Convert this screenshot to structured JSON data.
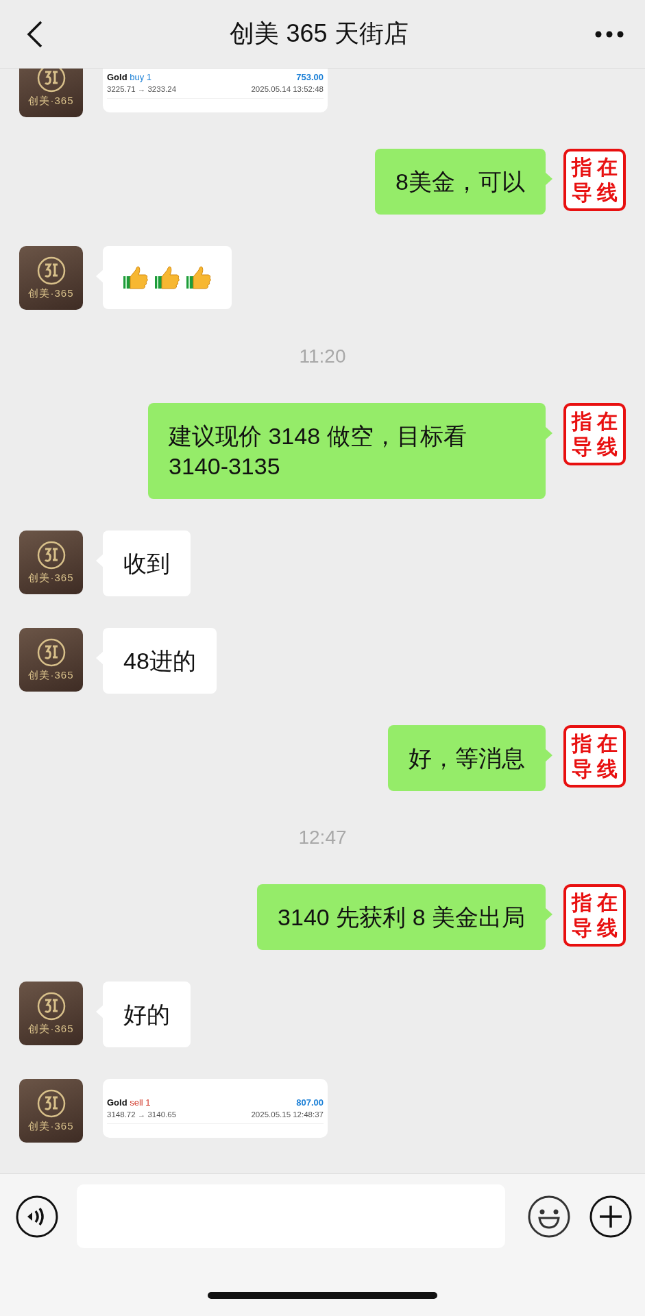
{
  "header": {
    "title": "创美 365 天街店"
  },
  "messages": [
    {
      "kind": "trade",
      "avatar_text": "创美·365",
      "symbol": "Gold",
      "action": "buy 1",
      "color": "#1a7fd6",
      "profit": "753.00",
      "prices": "3225.71 → 3233.24",
      "time": "2025.05.14 13:52:48"
    },
    {
      "kind": "outgoing",
      "text": "8美金，可以",
      "stamp": [
        "指",
        "在",
        "导",
        "线"
      ]
    },
    {
      "kind": "emoji",
      "avatar_text": "创美·365"
    },
    {
      "kind": "time",
      "text": "11:20"
    },
    {
      "kind": "outgoing",
      "text": "建议现价 3148 做空，目标看 3140-3135",
      "stamp": [
        "指",
        "在",
        "导",
        "线"
      ]
    },
    {
      "kind": "incoming",
      "avatar_text": "创美·365",
      "text": "收到"
    },
    {
      "kind": "incoming",
      "avatar_text": "创美·365",
      "text": "48进的"
    },
    {
      "kind": "outgoing",
      "text": "好，等消息",
      "stamp": [
        "指",
        "在",
        "导",
        "线"
      ]
    },
    {
      "kind": "time",
      "text": "12:47"
    },
    {
      "kind": "outgoing",
      "text": "3140 先获利 8 美金出局",
      "stamp": [
        "指",
        "在",
        "导",
        "线"
      ]
    },
    {
      "kind": "incoming",
      "avatar_text": "创美·365",
      "text": "好的"
    },
    {
      "kind": "trade",
      "avatar_text": "创美·365",
      "symbol": "Gold",
      "action": "sell 1",
      "color": "#d23a2b",
      "profit": "807.00",
      "prices": "3148.72 → 3140.65",
      "time": "2025.05.15 12:48:37"
    }
  ]
}
